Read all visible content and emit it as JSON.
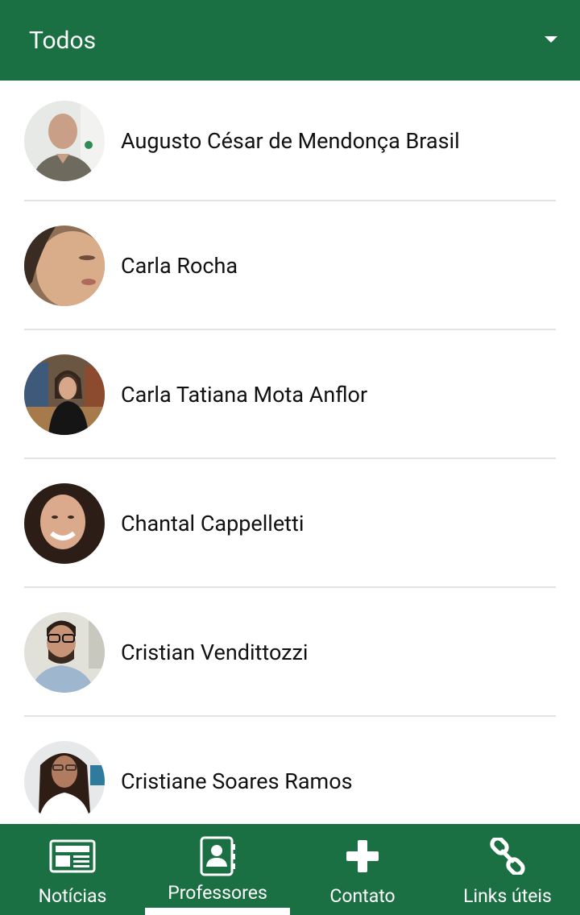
{
  "header": {
    "title": "Todos"
  },
  "professors": [
    {
      "name": "Augusto César de Mendonça Brasil"
    },
    {
      "name": "Carla Rocha"
    },
    {
      "name": "Carla Tatiana Mota Anflor"
    },
    {
      "name": "Chantal Cappelletti"
    },
    {
      "name": "Cristian Vendittozzi"
    },
    {
      "name": "Cristiane Soares Ramos"
    }
  ],
  "bottom_nav": {
    "items": [
      {
        "label": "Notícias",
        "icon": "newspaper-icon"
      },
      {
        "label": "Professores",
        "icon": "contact-book-icon",
        "active": true
      },
      {
        "label": "Contato",
        "icon": "plus-icon"
      },
      {
        "label": "Links úteis",
        "icon": "link-icon"
      }
    ]
  },
  "colors": {
    "primary": "#1b7043",
    "divider": "#e3e3e3"
  }
}
